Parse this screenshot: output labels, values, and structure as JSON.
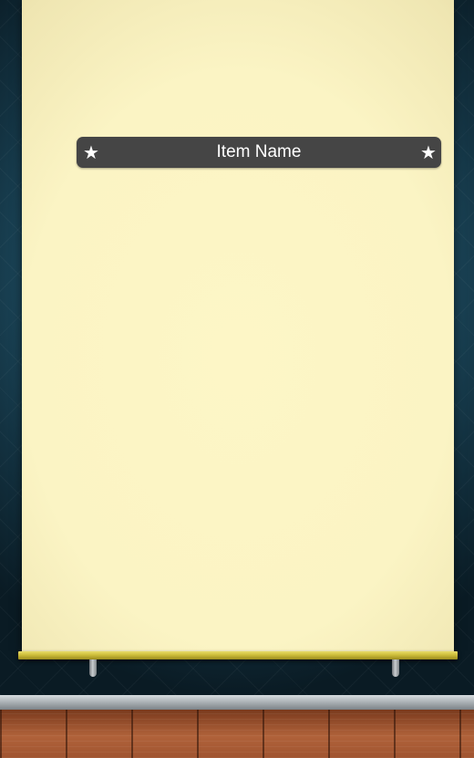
{
  "scene": {
    "wall_color": "#22566d",
    "banner_color": "#fbf4c4",
    "banner_bar_color": "#cdbd3a",
    "floor_color": "#b0623a"
  },
  "item_bar": {
    "name": "Item Name",
    "left_icon": "star-icon",
    "right_icon": "star-icon",
    "background_color": "#454545",
    "text_color": "#ffffff"
  }
}
